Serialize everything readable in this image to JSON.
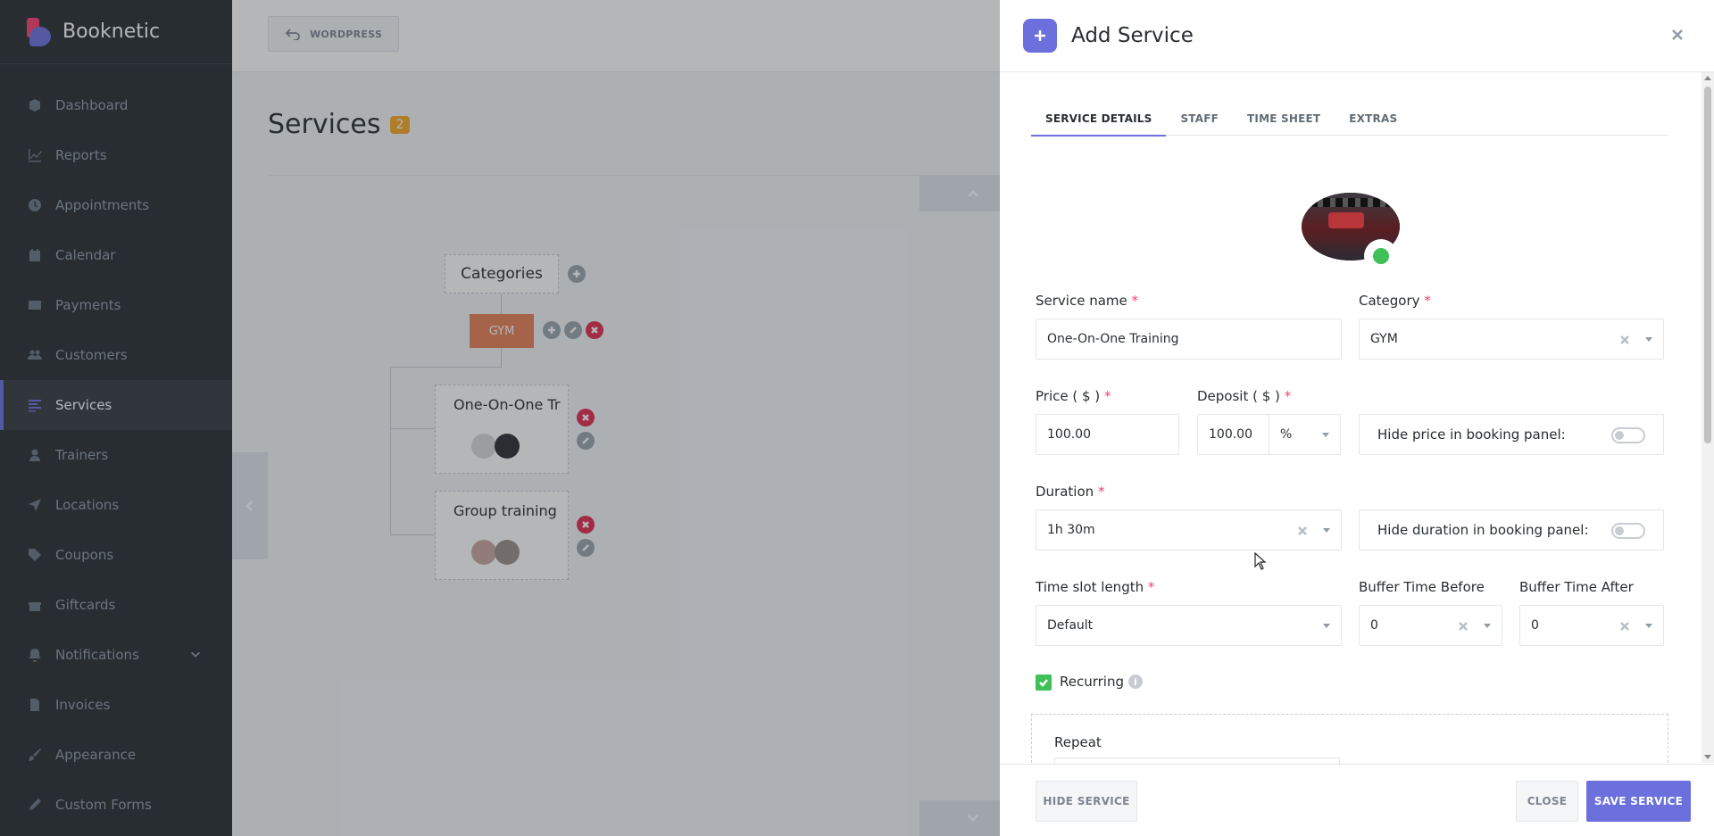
{
  "brand": {
    "name": "Booknetic"
  },
  "sidebar": {
    "items": [
      {
        "label": "Dashboard",
        "icon": "cube-icon"
      },
      {
        "label": "Reports",
        "icon": "chart-line-icon"
      },
      {
        "label": "Appointments",
        "icon": "clock-icon"
      },
      {
        "label": "Calendar",
        "icon": "calendar-icon"
      },
      {
        "label": "Payments",
        "icon": "credit-card-icon"
      },
      {
        "label": "Customers",
        "icon": "users-icon"
      },
      {
        "label": "Services",
        "icon": "list-icon"
      },
      {
        "label": "Trainers",
        "icon": "user-icon"
      },
      {
        "label": "Locations",
        "icon": "location-arrow-icon"
      },
      {
        "label": "Coupons",
        "icon": "tag-icon"
      },
      {
        "label": "Giftcards",
        "icon": "gift-icon"
      },
      {
        "label": "Notifications",
        "icon": "bell-icon"
      },
      {
        "label": "Invoices",
        "icon": "file-icon"
      },
      {
        "label": "Appearance",
        "icon": "brush-icon"
      },
      {
        "label": "Custom Forms",
        "icon": "pen-icon"
      }
    ],
    "active": "Services"
  },
  "topbar": {
    "wordpress_label": "WORDPRESS"
  },
  "page": {
    "title": "Services",
    "count": "2"
  },
  "tree": {
    "categories_label": "Categories",
    "category": "GYM",
    "services": [
      {
        "name": "One-On-One Training"
      },
      {
        "name": "Group training"
      }
    ]
  },
  "modal": {
    "title": "Add Service",
    "tabs": [
      "SERVICE DETAILS",
      "STAFF",
      "TIME SHEET",
      "EXTRAS"
    ],
    "active_tab": "SERVICE DETAILS",
    "fields": {
      "service_name_label": "Service name",
      "service_name_value": "One-On-One Training",
      "category_label": "Category",
      "category_value": "GYM",
      "price_label": "Price ( $ )",
      "price_value": "100.00",
      "deposit_label": "Deposit ( $ )",
      "deposit_value": "100.00",
      "deposit_type": "%",
      "hide_price_label": "Hide price in booking panel:",
      "duration_label": "Duration",
      "duration_value": "1h 30m",
      "hide_duration_label": "Hide duration in booking panel:",
      "time_slot_label": "Time slot length",
      "time_slot_value": "Default",
      "buffer_before_label": "Buffer Time Before",
      "buffer_before_value": "0",
      "buffer_after_label": "Buffer Time After",
      "buffer_after_value": "0",
      "recurring_label": "Recurring",
      "repeat_label": "Repeat",
      "required_mark": "*",
      "info_glyph": "i"
    },
    "footer": {
      "hide_service": "HIDE SERVICE",
      "close": "CLOSE",
      "save": "SAVE SERVICE"
    }
  },
  "colors": {
    "sidebar_bg": "#292d32",
    "accent": "#6c70dc",
    "category_orange": "#e88155",
    "success_green": "#40c057",
    "danger_red": "#e42c4f",
    "badge_orange": "#f9a825"
  }
}
